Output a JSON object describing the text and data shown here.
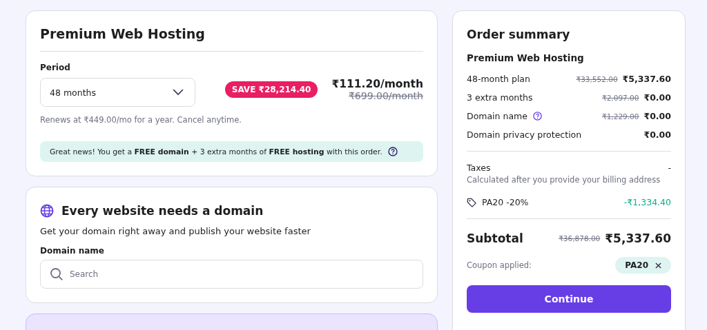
{
  "plan_card": {
    "title": "Premium Web Hosting",
    "period_label": "Period",
    "period_value": "48 months",
    "save_badge": "SAVE ₹28,214.40",
    "price": "₹111.20/month",
    "old_price": "₹699.00/month",
    "renewal_note": "Renews at ₹449.00/mo for a year. Cancel anytime.",
    "promo_banner": "Great news! You get a **FREE domain** + 3 extra months of **FREE hosting** with this order."
  },
  "domain_card": {
    "title": "Every website needs a domain",
    "subtitle": "Get your domain right away and publish your website faster",
    "field_label": "Domain name",
    "search": {
      "placeholder": "Search"
    }
  },
  "order_summary": {
    "title": "Order summary",
    "product": "Premium Web Hosting",
    "lines": [
      {
        "label": "48-month plan",
        "old_price": "₹33,552.00",
        "price": "₹5,337.60",
        "help": false
      },
      {
        "label": "3 extra months",
        "old_price": "₹2,097.00",
        "price": "₹0.00",
        "help": false
      },
      {
        "label": "Domain name",
        "old_price": "₹1,229.00",
        "price": "₹0.00",
        "help": true
      },
      {
        "label": "Domain privacy protection",
        "price": "₹0.00",
        "help": false
      }
    ],
    "taxes": {
      "label": "Taxes",
      "value": "-",
      "note": "Calculated after you provide your billing address"
    },
    "discount": {
      "label": "PA20 -20%",
      "value": "-₹1,334.40"
    },
    "subtotal": {
      "label": "Subtotal",
      "old_price": "₹36,878.00",
      "price": "₹5,337.60"
    },
    "coupon": {
      "label": "Coupon applied:",
      "code": "PA20"
    },
    "continue_button": "Continue"
  }
}
